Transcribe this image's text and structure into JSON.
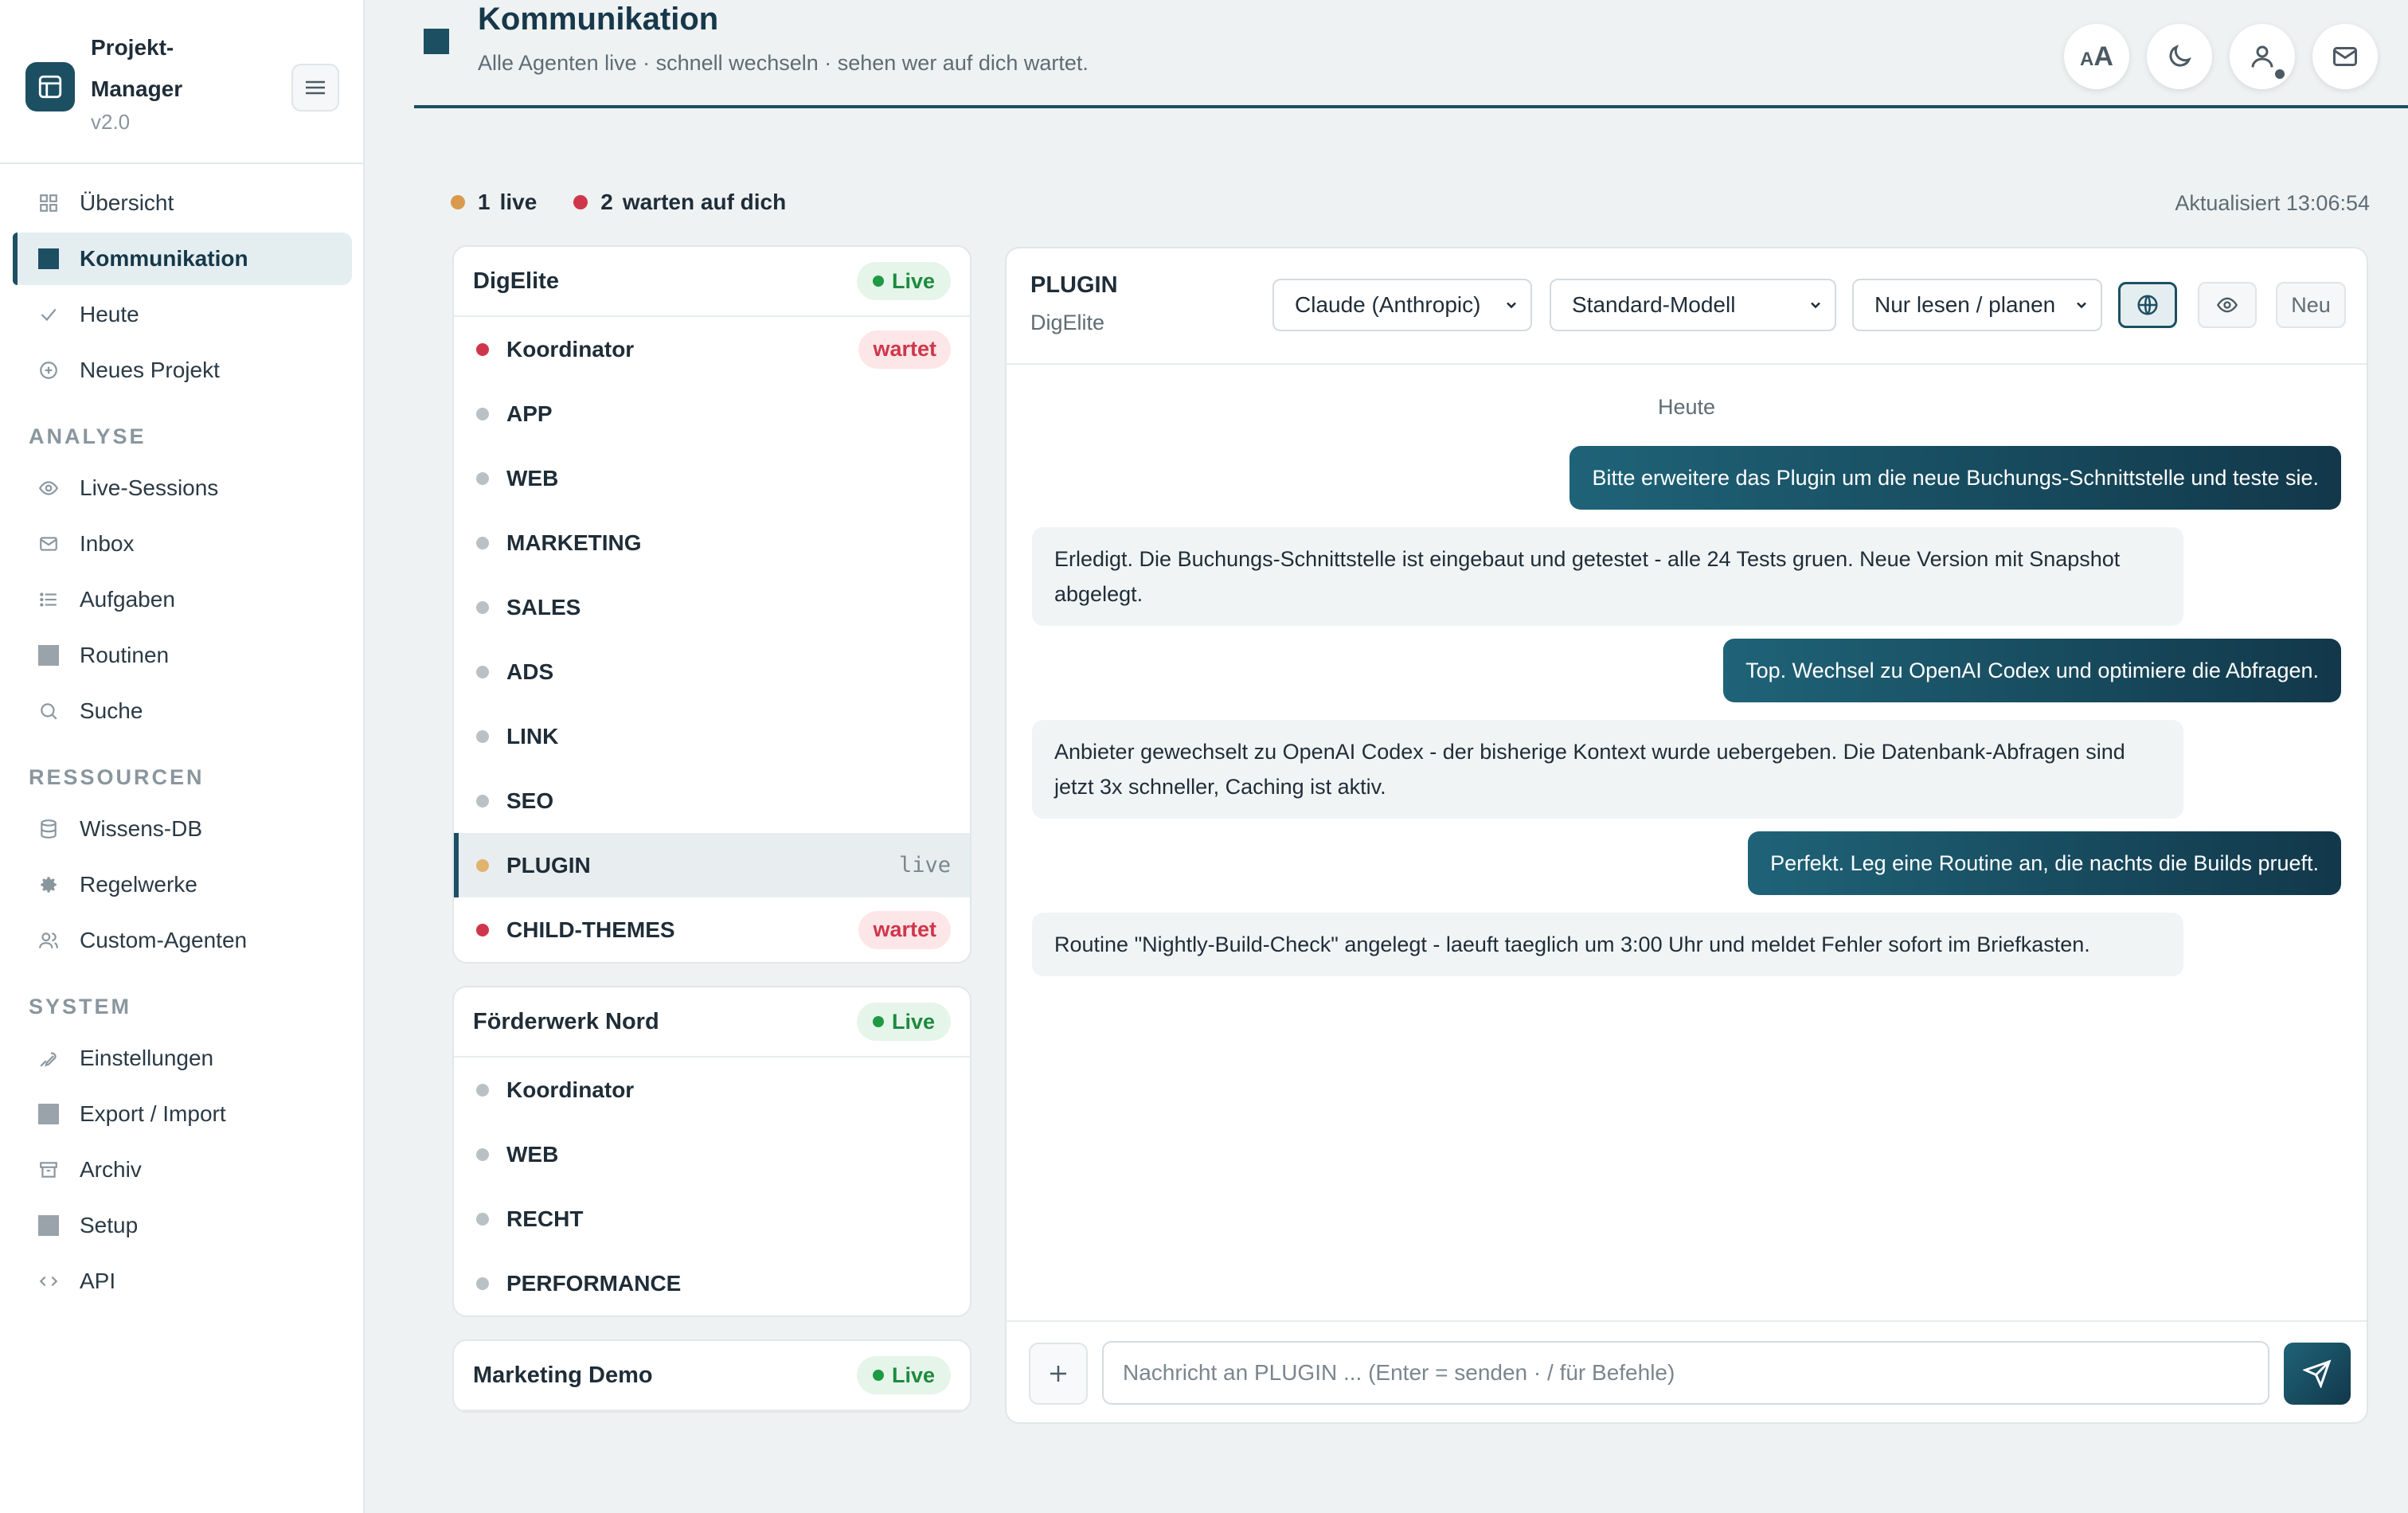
{
  "brand": {
    "title": "Projekt-Manager",
    "version": "v2.0"
  },
  "nav": {
    "main": [
      {
        "label": "Übersicht",
        "icon": "grid-icon"
      },
      {
        "label": "Kommunikation",
        "icon": "square-icon",
        "active": true
      },
      {
        "label": "Heute",
        "icon": "check-icon"
      },
      {
        "label": "Neues Projekt",
        "icon": "plus-circle-icon"
      }
    ],
    "analyse_label": "ANALYSE",
    "analyse": [
      {
        "label": "Live-Sessions",
        "icon": "eye-icon"
      },
      {
        "label": "Inbox",
        "icon": "mail-icon"
      },
      {
        "label": "Aufgaben",
        "icon": "list-icon"
      },
      {
        "label": "Routinen",
        "icon": "square-icon"
      },
      {
        "label": "Suche",
        "icon": "search-icon"
      }
    ],
    "ressourcen_label": "RESSOURCEN",
    "ressourcen": [
      {
        "label": "Wissens-DB",
        "icon": "database-icon"
      },
      {
        "label": "Regelwerke",
        "icon": "gear-icon"
      },
      {
        "label": "Custom-Agenten",
        "icon": "users-icon"
      }
    ],
    "system_label": "SYSTEM",
    "system": [
      {
        "label": "Einstellungen",
        "icon": "wrench-icon"
      },
      {
        "label": "Export / Import",
        "icon": "square-icon"
      },
      {
        "label": "Archiv",
        "icon": "archive-icon"
      },
      {
        "label": "Setup",
        "icon": "square-icon"
      },
      {
        "label": "API",
        "icon": "code-icon"
      }
    ]
  },
  "header": {
    "title": "Kommunikation",
    "subtitle": "Alle Agenten live · schnell wechseln · sehen wer auf dich wartet.",
    "font_size_label": "AA"
  },
  "status": {
    "live_count": "1",
    "live_label": "live",
    "waiting_count": "2",
    "waiting_label": "warten auf dich",
    "updated": "Aktualisiert 13:06:54"
  },
  "projects": [
    {
      "name": "DigElite",
      "status": "Live",
      "agents": [
        {
          "name": "Koordinator",
          "state": "wartet"
        },
        {
          "name": "APP"
        },
        {
          "name": "WEB"
        },
        {
          "name": "MARKETING"
        },
        {
          "name": "SALES"
        },
        {
          "name": "ADS"
        },
        {
          "name": "LINK"
        },
        {
          "name": "SEO"
        },
        {
          "name": "PLUGIN",
          "state": "live",
          "selected": true
        },
        {
          "name": "CHILD-THEMES",
          "state": "wartet"
        }
      ]
    },
    {
      "name": "Förderwerk Nord",
      "status": "Live",
      "agents": [
        {
          "name": "Koordinator"
        },
        {
          "name": "WEB"
        },
        {
          "name": "RECHT"
        },
        {
          "name": "PERFORMANCE"
        }
      ]
    },
    {
      "name": "Marketing Demo",
      "status": "Live",
      "agents": []
    }
  ],
  "chat": {
    "agent": "PLUGIN",
    "project": "DigElite",
    "provider": "Claude (Anthropic)",
    "model": "Standard-Modell",
    "mode": "Nur lesen / planen",
    "new_label": "Neu",
    "day": "Heute",
    "messages": [
      {
        "role": "user",
        "text": "Bitte erweitere das Plugin um die neue Buchungs-Schnittstelle und teste sie."
      },
      {
        "role": "bot",
        "text": "Erledigt. Die Buchungs-Schnittstelle ist eingebaut und getestet - alle 24 Tests gruen. Neue Version mit Snapshot abgelegt."
      },
      {
        "role": "user",
        "text": "Top. Wechsel zu OpenAI Codex und optimiere die Abfragen."
      },
      {
        "role": "bot",
        "text": "Anbieter gewechselt zu OpenAI Codex - der bisherige Kontext wurde uebergeben. Die Datenbank-Abfragen sind jetzt 3x schneller, Caching ist aktiv."
      },
      {
        "role": "user",
        "text": "Perfekt. Leg eine Routine an, die nachts die Builds prueft."
      },
      {
        "role": "bot",
        "text": "Routine \"Nightly-Build-Check\" angelegt - laeuft taeglich um 3:00 Uhr und meldet Fehler sofort im Briefkasten."
      }
    ],
    "input_placeholder": "Nachricht an PLUGIN ... (Enter = senden · / für Befehle)",
    "input_value": ""
  },
  "colors": {
    "accent": "#1d4f63",
    "live": "#d99a4e",
    "waiting": "#d0364b",
    "live_pill_bg": "#e6f5ea",
    "live_pill_text": "#1e8a3e"
  }
}
